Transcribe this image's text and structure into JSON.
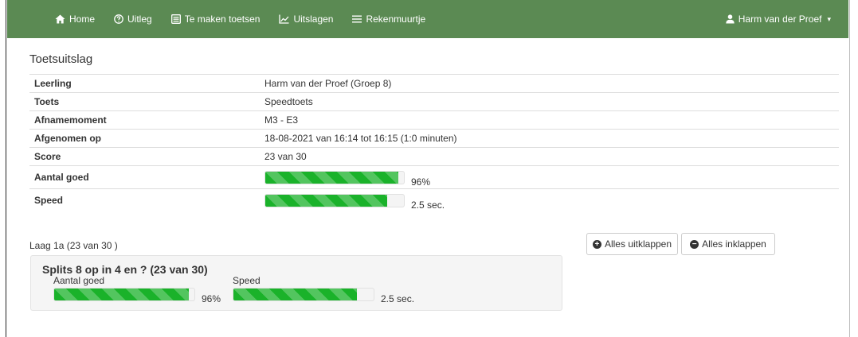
{
  "nav": {
    "items": [
      {
        "icon": "home-icon",
        "label": "Home"
      },
      {
        "icon": "question-icon",
        "label": "Uitleg"
      },
      {
        "icon": "list-icon",
        "label": "Te maken toetsen"
      },
      {
        "icon": "chart-icon",
        "label": "Uitslagen"
      },
      {
        "icon": "menu-icon",
        "label": "Rekenmuurtje"
      }
    ],
    "user": {
      "icon": "user-icon",
      "label": "Harm van der Proef"
    }
  },
  "page": {
    "title": "Toetsuitslag"
  },
  "info": {
    "rows": [
      {
        "label": "Leerling",
        "value": "Harm van der Proef (Groep 8)"
      },
      {
        "label": "Toets",
        "value": "Speedtoets"
      },
      {
        "label": "Afnamemoment",
        "value": "M3 - E3"
      },
      {
        "label": "Afgenomen op",
        "value": "18-08-2021 van 16:14 tot 16:15 (1:0 minuten)"
      },
      {
        "label": "Score",
        "value": "23 van 30"
      }
    ],
    "aantal_goed": {
      "label": "Aantal goed",
      "percent": 96,
      "text": "96%"
    },
    "speed": {
      "label": "Speed",
      "percent": 88,
      "text": "2.5 sec."
    }
  },
  "level": {
    "label": "Laag 1a (23 van 30 )"
  },
  "buttons": {
    "expand": "Alles uitklappen",
    "collapse": "Alles inklappen"
  },
  "panel": {
    "title": "Splits 8 op in 4 en ? (23 van 30)",
    "aantal_goed": {
      "label": "Aantal goed",
      "percent": 96,
      "text": "96%"
    },
    "speed": {
      "label": "Speed",
      "percent": 88,
      "text": "2.5 sec."
    }
  },
  "colors": {
    "navbar": "#5b8a53",
    "progress": "#1ab22a"
  }
}
